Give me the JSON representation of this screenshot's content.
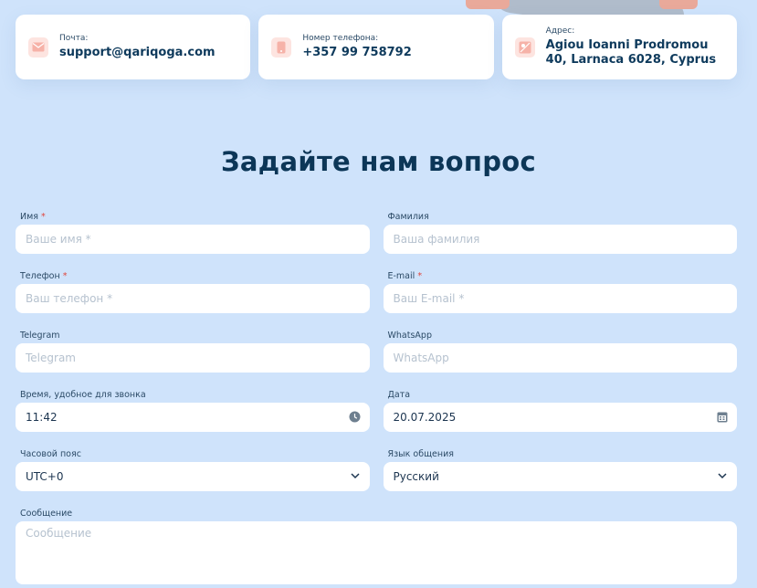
{
  "contacts": {
    "email": {
      "label": "Почта:",
      "value": "support@qariqoga.com",
      "icon": "mail-icon"
    },
    "phone": {
      "label": "Номер телефона:",
      "value": "+357 99 758792",
      "icon": "phone-icon"
    },
    "address": {
      "label": "Адрес:",
      "value": "Agiou Ioanni Prodromou 40, Larnaca 6028, Cyprus",
      "icon": "map-pin-icon"
    }
  },
  "form": {
    "title": "Задайте нам вопрос",
    "first_name": {
      "label": "Имя",
      "required_mark": "*",
      "placeholder": "Ваше имя *"
    },
    "last_name": {
      "label": "Фамилия",
      "placeholder": "Ваша фамилия"
    },
    "phone": {
      "label": "Телефон",
      "required_mark": "*",
      "placeholder": "Ваш телефон *"
    },
    "email": {
      "label": "E-mail",
      "required_mark": "*",
      "placeholder": "Ваш E-mail *"
    },
    "telegram": {
      "label": "Telegram",
      "placeholder": "Telegram"
    },
    "whatsapp": {
      "label": "WhatsApp",
      "placeholder": "WhatsApp"
    },
    "call_time": {
      "label": "Время, удобное для звонка",
      "value": "11:42",
      "icon": "clock-icon"
    },
    "date": {
      "label": "Дата",
      "value": "20.07.2025",
      "icon": "calendar-icon"
    },
    "timezone": {
      "label": "Часовой пояс",
      "value": "UTC+0",
      "icon": "chevron-down-icon"
    },
    "language": {
      "label": "Язык общения",
      "value": "Русский",
      "icon": "chevron-down-icon"
    },
    "message": {
      "label": "Сообщение",
      "placeholder": "Сообщение"
    }
  },
  "colors": {
    "background": "#cfe3fb",
    "title": "#0c3657",
    "accent": "#e0453c",
    "icon_bg": "#fde4e0"
  }
}
